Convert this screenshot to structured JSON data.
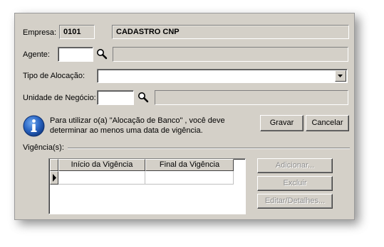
{
  "empresa": {
    "label": "Empresa:",
    "code": "0101",
    "name": "CADASTRO CNP"
  },
  "agente": {
    "label": "Agente:",
    "value": "",
    "description": ""
  },
  "tipo_alocacao": {
    "label": "Tipo de Alocação:",
    "value": ""
  },
  "unidade_negocio": {
    "label": "Unidade de Negócio:",
    "value": "",
    "description": ""
  },
  "info": {
    "line1": "Para utilizar o(a) \"Alocação de Banco\" , você deve",
    "line2": "determinar ao menos uma data de vigência.",
    "icon": "info-icon"
  },
  "buttons": {
    "gravar": "Gravar",
    "cancelar": "Cancelar",
    "adicionar": "Adicionar...",
    "excluir": "Excluir",
    "editar": "Editar/Detalhes..."
  },
  "vigencias": {
    "label": "Vigência(s):",
    "columns": [
      "Início da Vigência",
      "Final da Vigência"
    ],
    "rows": [
      {
        "inicio": "",
        "final": ""
      }
    ]
  },
  "colors": {
    "panel": "#d4d0c8",
    "info_blue": "#1f5fb5"
  }
}
